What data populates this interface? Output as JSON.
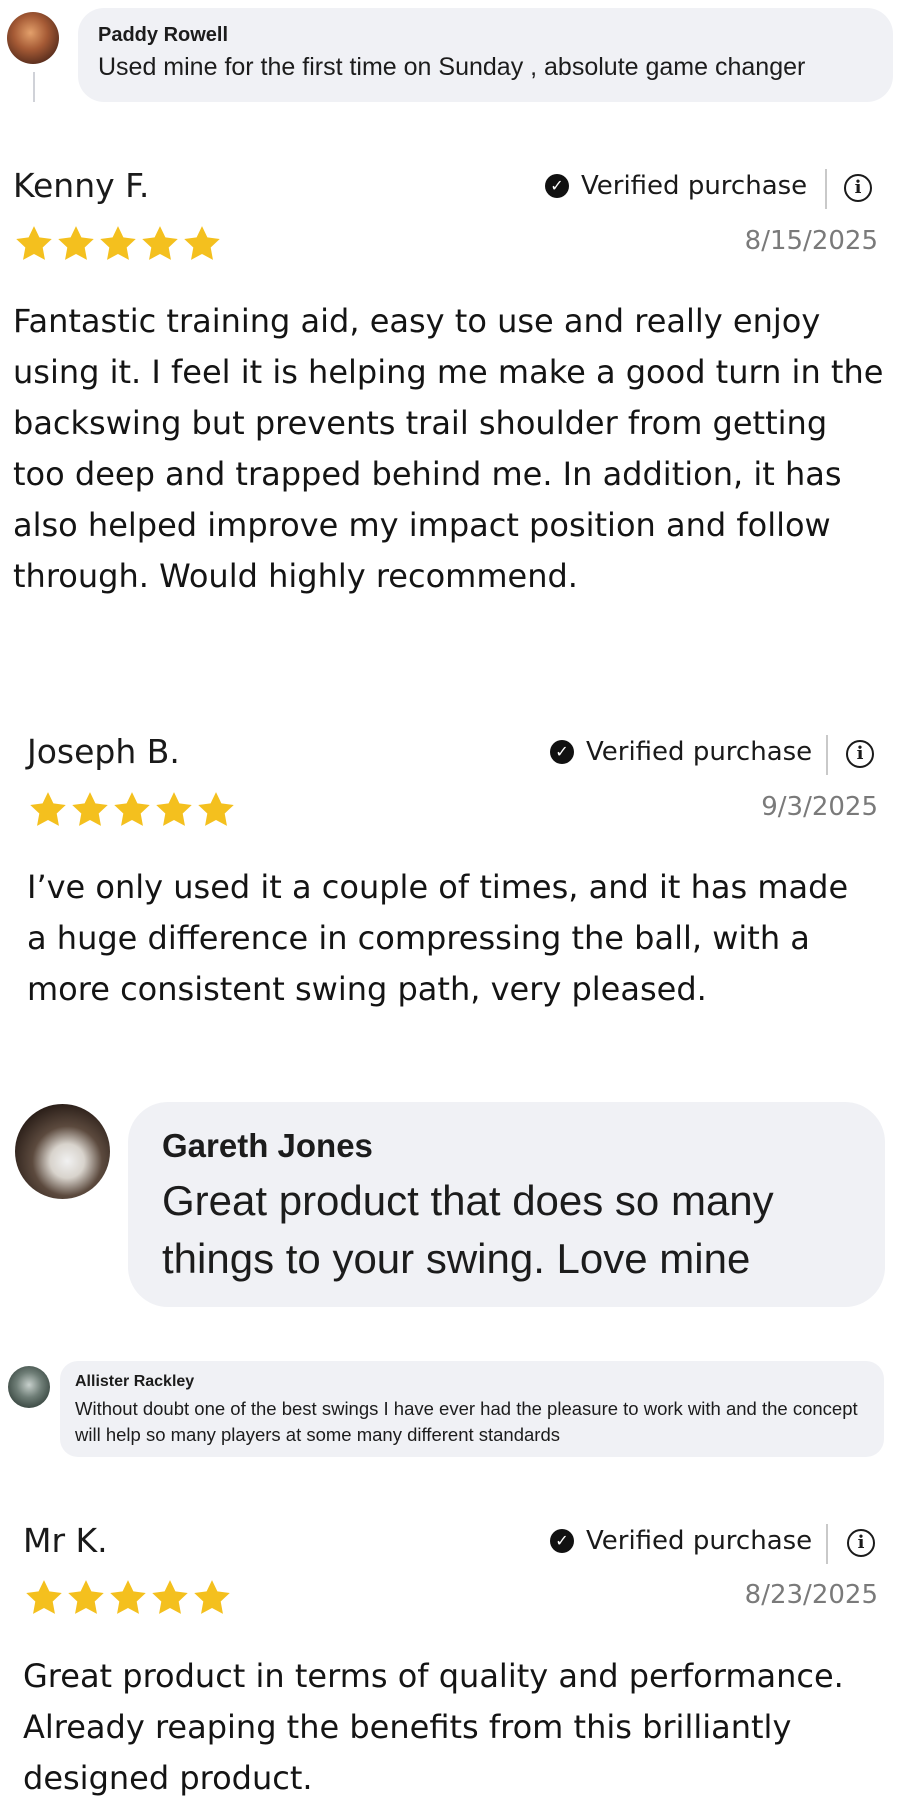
{
  "comments": [
    {
      "name": "Paddy Rowell",
      "text": "Used mine for the first time on Sunday , absolute game changer"
    },
    {
      "name": "Gareth Jones",
      "text": "Great product that does so many things to your swing. Love mine"
    },
    {
      "name": "Allister Rackley",
      "text": "Without doubt one of the best swings I have ever had the pleasure to work with and the concept will help so many players at some many different standards"
    }
  ],
  "reviews": [
    {
      "name": "Kenny F.",
      "verified_label": "Verified purchase",
      "rating": 5,
      "date": "8/15/2025",
      "text": "Fantastic training aid, easy to use and really enjoy using it. I feel it is helping me make a good turn in the backswing but prevents trail shoulder from getting too deep and trapped behind me. In addition, it has also helped improve my impact position and follow through. Would highly recommend."
    },
    {
      "name": "Joseph B.",
      "verified_label": "Verified purchase",
      "rating": 5,
      "date": "9/3/2025",
      "text": "I’ve only used it a couple of times, and it has made a huge difference in compressing the ball, with a more consistent swing path, very pleased."
    },
    {
      "name": "Mr K.",
      "verified_label": "Verified purchase",
      "rating": 5,
      "date": "8/23/2025",
      "text": "Great product in terms of quality and performance. Already reaping the benefits from this brilliantly designed product."
    }
  ],
  "colors": {
    "star": "#f4c01e",
    "bubble": "#f0f1f5",
    "date": "#7a7a7a"
  },
  "icons": {
    "verified": "check-circle-icon",
    "info": "info-icon",
    "star": "star-icon"
  }
}
